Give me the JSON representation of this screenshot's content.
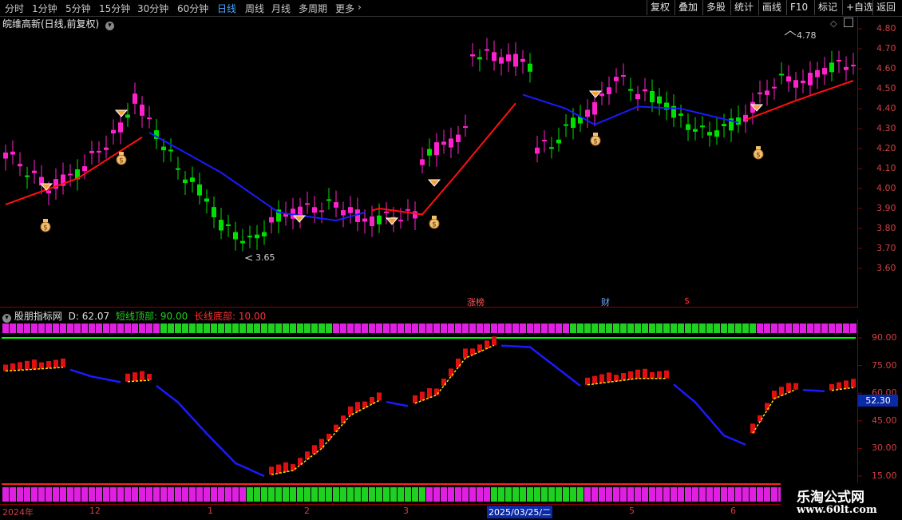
{
  "toolbar": {
    "periods": [
      "分时",
      "1分钟",
      "5分钟",
      "15分钟",
      "30分钟",
      "60分钟",
      "日线",
      "周线",
      "月线",
      "多周期",
      "更多"
    ],
    "active_period": "日线",
    "more_arrow": "›",
    "right_buttons": [
      "复权",
      "叠加",
      "多股",
      "统计",
      "画线",
      "F10",
      "标记",
      "+自选",
      "返回"
    ]
  },
  "main_chart": {
    "title": "皖维高新(日线,前复权)",
    "high_label": "4.78",
    "low_label": "3.65",
    "price_axis": [
      "4.80",
      "4.70",
      "4.60",
      "4.50",
      "4.40",
      "4.30",
      "4.20",
      "4.10",
      "4.00",
      "3.90",
      "3.80",
      "3.70",
      "3.60"
    ],
    "events": [
      {
        "text": "涨榜",
        "color": "#ff5555"
      },
      {
        "text": "财",
        "color": "#6aa8ff"
      },
      {
        "text": "$",
        "color": "#ff3030"
      }
    ],
    "colors": {
      "up": "#ff22cc",
      "down": "#00e000",
      "ma_up": "#ff1010",
      "ma_down": "#1a1aff"
    },
    "icon_names": [
      "money-bag-icon",
      "diamond-marker-icon"
    ]
  },
  "indicator": {
    "name": "股朋指标网",
    "d_label": "D:",
    "d_value": "62.07",
    "short_top_label": "短线顶部:",
    "short_top_value": "90.00",
    "long_bottom_label": "长线底部:",
    "long_bottom_value": "10.00",
    "axis": [
      "90.00",
      "75.00",
      "60.00",
      "45.00",
      "30.00",
      "15.00"
    ],
    "current_value": "52.30"
  },
  "date_axis": [
    "2024年",
    "12",
    "1",
    "2",
    "3",
    "2025/03/25/二",
    "5",
    "6"
  ],
  "watermark": {
    "title": "乐淘公式网",
    "url": "www.60lt.com"
  }
}
